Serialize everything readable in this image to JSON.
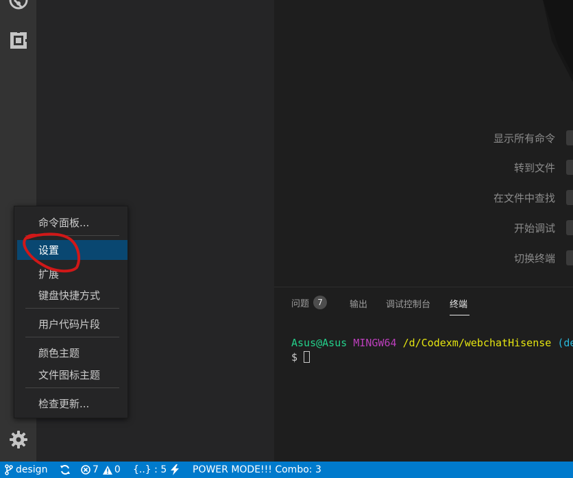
{
  "activity_bar": {
    "icons": [
      "debug-icon",
      "extensions-icon",
      "gear-icon"
    ]
  },
  "editor": {
    "shortcuts": [
      {
        "label": "显示所有命令"
      },
      {
        "label": "转到文件"
      },
      {
        "label": "在文件中查找"
      },
      {
        "label": "开始调试"
      },
      {
        "label": "切换终端"
      }
    ]
  },
  "panel": {
    "tabs": [
      {
        "label": "问题",
        "badge": "7"
      },
      {
        "label": "输出"
      },
      {
        "label": "调试控制台"
      },
      {
        "label": "终端",
        "active": true
      }
    ],
    "terminal": {
      "user_host": "Asus@Asus",
      "shell": "MINGW64",
      "path": "/d/Codexm/webchatHisense",
      "branch_fragment": "(de",
      "prompt": "$"
    }
  },
  "menu": {
    "items": [
      {
        "label": "命令面板..."
      },
      {
        "label": "设置",
        "selected": true
      },
      {
        "label": "扩展"
      },
      {
        "label": "键盘快捷方式"
      },
      {
        "label": "用户代码片段"
      },
      {
        "label": "颜色主题"
      },
      {
        "label": "文件图标主题"
      },
      {
        "label": "检查更新..."
      }
    ]
  },
  "status_bar": {
    "branch": "design",
    "errors": "7",
    "warnings": "0",
    "json_info": "{..} : 5",
    "power_mode": "POWER MODE!!! Combo: 3"
  },
  "colors": {
    "status_bar": "#007acc",
    "menu_selected": "#094771",
    "annotation": "#d01818"
  }
}
